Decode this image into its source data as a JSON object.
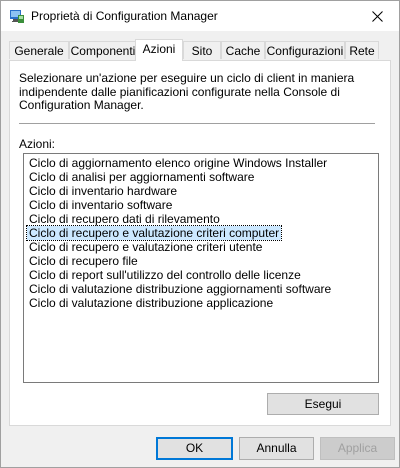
{
  "window": {
    "title": "Proprietà di Configuration Manager"
  },
  "tabs": [
    {
      "label": "Generale"
    },
    {
      "label": "Componenti"
    },
    {
      "label": "Azioni",
      "active": true
    },
    {
      "label": "Sito"
    },
    {
      "label": "Cache"
    },
    {
      "label": "Configurazioni"
    },
    {
      "label": "Rete"
    }
  ],
  "actions_tab": {
    "description": "Selezionare un'azione per eseguire un ciclo di client in maniera indipendente dalle pianificazioni configurate nella Console di Configuration Manager.",
    "list_label": "Azioni:",
    "items": [
      "Ciclo di aggiornamento elenco origine Windows Installer",
      "Ciclo di analisi per aggiornamenti software",
      "Ciclo di inventario hardware",
      "Ciclo di inventario software",
      "Ciclo di recupero dati di rilevamento",
      "Ciclo di recupero e valutazione criteri computer",
      "Ciclo di recupero e valutazione criteri utente",
      "Ciclo di recupero file",
      "Ciclo di report sull'utilizzo del controllo delle licenze",
      "Ciclo di valutazione distribuzione aggiornamenti software",
      "Ciclo di valutazione distribuzione applicazione"
    ],
    "selected_index": 5,
    "run_button_label": "Esegui"
  },
  "footer": {
    "ok_label": "OK",
    "cancel_label": "Annulla",
    "apply_label": "Applica"
  }
}
